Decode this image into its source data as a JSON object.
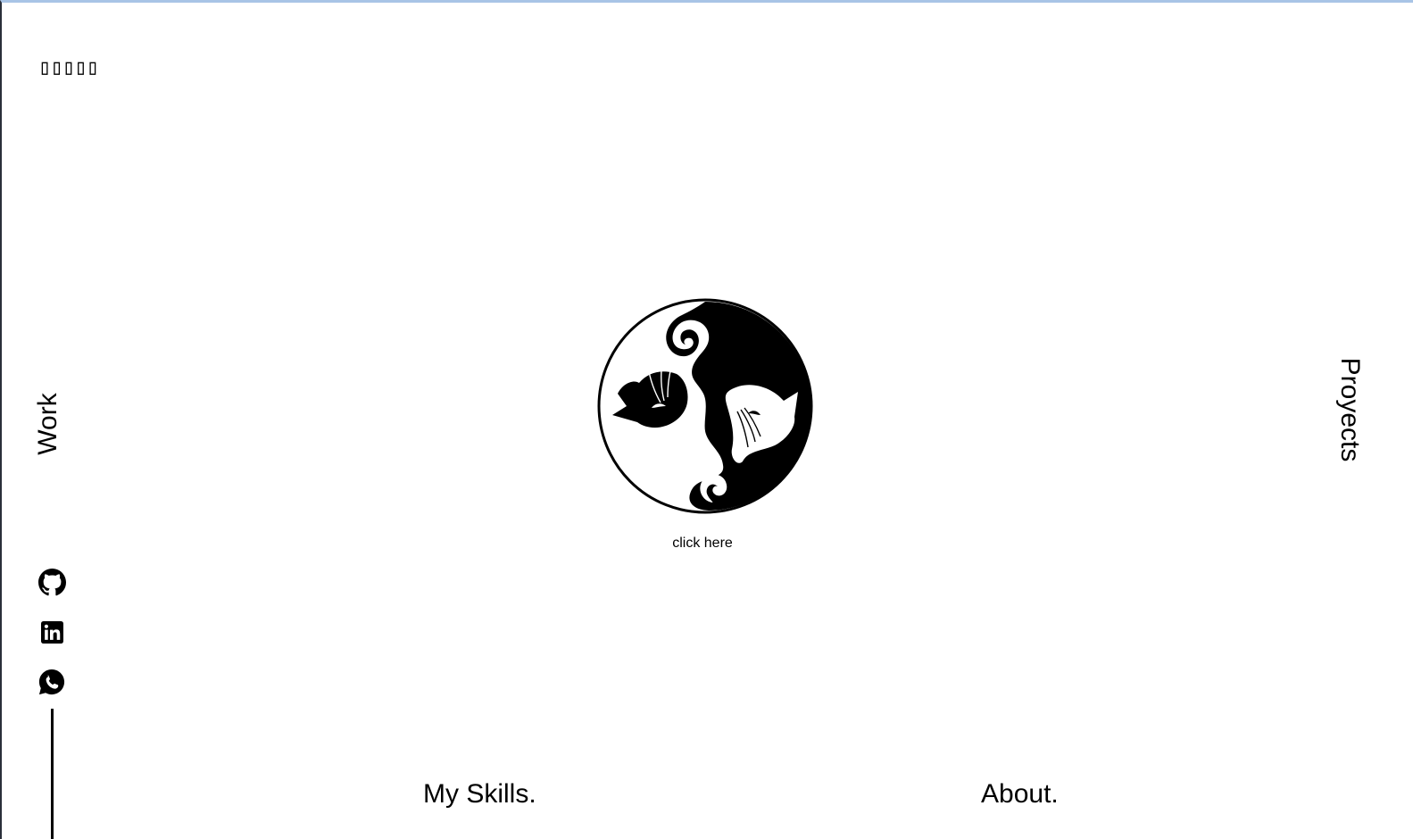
{
  "header": {
    "logo_text": "▯▯▯▯▯"
  },
  "nav": {
    "left_label": "Work",
    "right_label": "Proyects"
  },
  "social": [
    {
      "icon": "github-icon"
    },
    {
      "icon": "linkedin-icon"
    },
    {
      "icon": "whatsapp-icon"
    }
  ],
  "hero": {
    "logo_icon": "yin-yang-cats-icon",
    "cta_label": "click here"
  },
  "bottom_nav": {
    "skills_label": "My Skills.",
    "about_label": "About."
  },
  "colors": {
    "background": "#ffffff",
    "foreground": "#000000"
  }
}
